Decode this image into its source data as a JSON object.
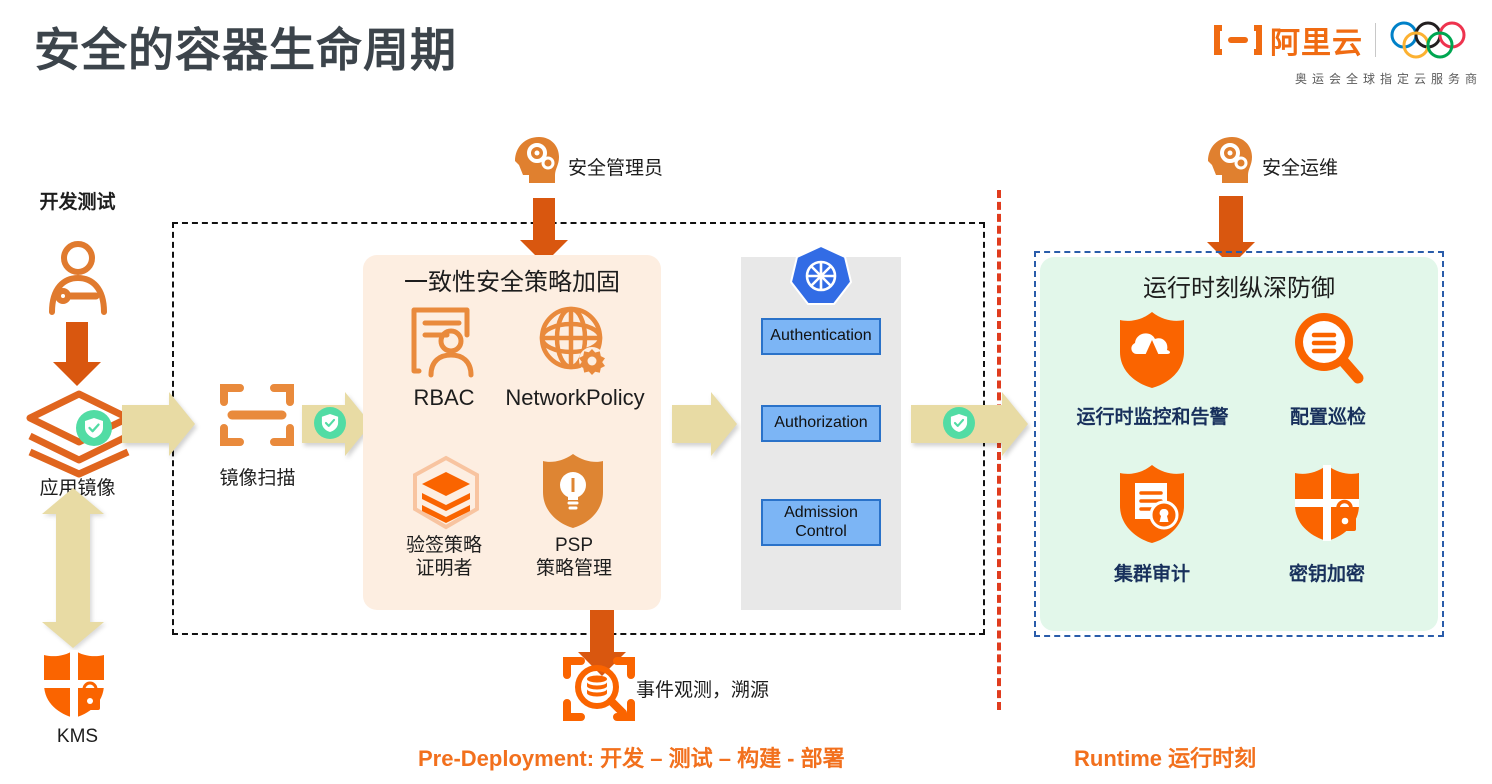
{
  "header": {
    "title": "安全的容器生命周期",
    "brand_name": "阿里云",
    "brand_sub": "奥运会全球指定云服务商"
  },
  "left_flow": {
    "dev_test_label": "开发测试",
    "app_image_label": "应用镜像",
    "kms_label": "KMS"
  },
  "scan": {
    "label": "镜像扫描"
  },
  "actors": {
    "security_admin": "安全管理员",
    "security_ops": "安全运维"
  },
  "policy_box": {
    "title": "一致性安全策略加固",
    "items": [
      {
        "label": "RBAC",
        "icon": "rbac-document-person-icon"
      },
      {
        "label": "NetworkPolicy",
        "icon": "network-globe-gear-icon"
      },
      {
        "label": "验签策略\n证明者",
        "icon": "signed-layers-icon"
      },
      {
        "label": "PSP\n策略管理",
        "icon": "shield-bulb-icon"
      }
    ]
  },
  "k8s_box": {
    "logo": "kubernetes-icon",
    "items": [
      "Authentication",
      "Authorization",
      "Admission\nControl"
    ]
  },
  "runtime_box": {
    "title": "运行时刻纵深防御",
    "items": [
      {
        "label": "运行时监控和告警",
        "icon": "shield-cloud-icon"
      },
      {
        "label": "配置巡检",
        "icon": "magnifier-list-icon"
      },
      {
        "label": "集群审计",
        "icon": "shield-audit-icon"
      },
      {
        "label": "密钥加密",
        "icon": "shield-lock-icon"
      }
    ]
  },
  "observability": {
    "label": "事件观测，溯源"
  },
  "footer": {
    "pre_deployment": "Pre-Deployment: 开发 – 测试 – 构建 - 部署",
    "runtime": "Runtime 运行时刻"
  },
  "colors": {
    "orange": "#f2701d",
    "deep_orange": "#d9570f",
    "khaki": "#e8dba4",
    "green_badge": "#52dca4",
    "k8s_blue": "#326ce5",
    "pill_blue": "#7cb5f5",
    "mint": "#e2f7ea",
    "peach": "#fdeee1",
    "navy": "#18305c",
    "red_divider": "#e03c1e"
  }
}
